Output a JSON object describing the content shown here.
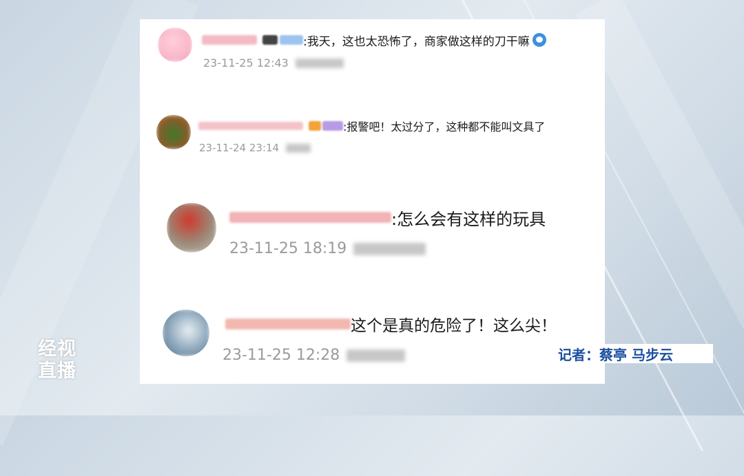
{
  "comments": [
    {
      "text": ":我天，这也太恐怖了，商家做这样的刀干嘛",
      "time": "23-11-25 12:43",
      "emoji": "doraemon-emoji"
    },
    {
      "text": ":报警吧！太过分了，这种都不能叫文具了",
      "time": "23-11-24 23:14"
    },
    {
      "text": ":怎么会有这样的玩具",
      "time": "23-11-25 18:19"
    },
    {
      "text": "这个是真的危险了！这么尖！",
      "time": "23-11-25 12:28"
    }
  ],
  "reporter": "记者：蔡亭 马步云",
  "logo": {
    "line1": "经视",
    "line2": "直播"
  },
  "colors": {
    "reporter_text": "#1c4fa0",
    "time_text": "#9a9a9a",
    "card_bg": "#ffffff"
  }
}
